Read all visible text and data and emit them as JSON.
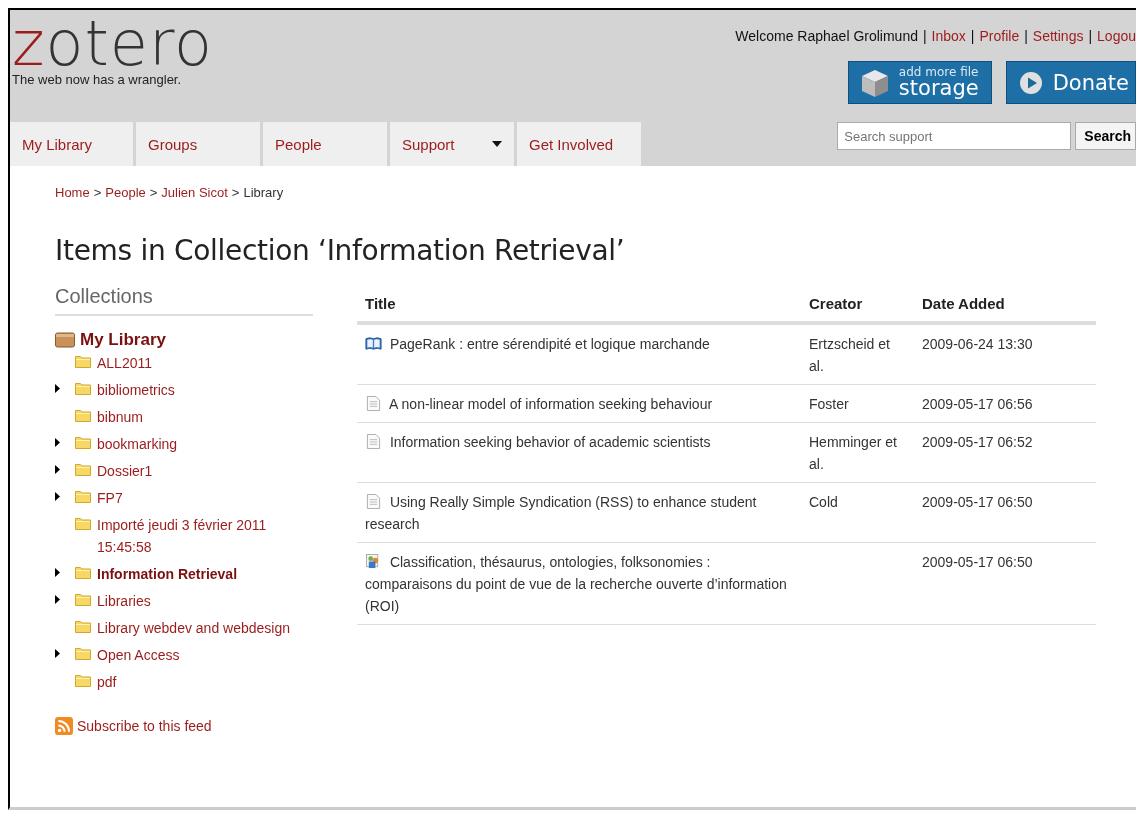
{
  "header": {
    "logo": [
      {
        "text": "z",
        "kind": "accent"
      },
      {
        "text": "otero",
        "kind": "plain"
      }
    ],
    "tagline": "The web now has a wrangler.",
    "user_links": [
      {
        "text": "Welcome Raphael Grolimund",
        "kind": "text"
      },
      {
        "text": "|",
        "kind": "separator"
      },
      {
        "text": "Inbox",
        "kind": "link"
      },
      {
        "text": "|",
        "kind": "separator"
      },
      {
        "text": "Profile",
        "kind": "link"
      },
      {
        "text": "|",
        "kind": "separator"
      },
      {
        "text": "Settings",
        "kind": "link"
      },
      {
        "text": "|",
        "kind": "separator"
      },
      {
        "text": "Logou",
        "kind": "link"
      }
    ],
    "storage_button": {
      "small": "add more file",
      "large": "storage"
    },
    "donate_button": "Donate",
    "nav": [
      {
        "label": "My Library",
        "dropdown": false
      },
      {
        "label": "Groups",
        "dropdown": false
      },
      {
        "label": "People",
        "dropdown": false
      },
      {
        "label": "Support",
        "dropdown": true
      },
      {
        "label": "Get Involved",
        "dropdown": false
      }
    ],
    "search": {
      "placeholder": "Search support",
      "button": "Search"
    }
  },
  "breadcrumb": [
    {
      "text": "Home",
      "kind": "link"
    },
    {
      "text": ">",
      "kind": "separator"
    },
    {
      "text": "People",
      "kind": "link"
    },
    {
      "text": ">",
      "kind": "separator"
    },
    {
      "text": "Julien Sicot",
      "kind": "link"
    },
    {
      "text": ">",
      "kind": "separator"
    },
    {
      "text": "Library",
      "kind": "current"
    }
  ],
  "page_title": "Items in Collection ‘Information Retrieval’",
  "collections": {
    "heading": "Collections",
    "root": {
      "label": "My Library",
      "children": [
        {
          "label": "ALL2011",
          "has_children": false,
          "selected": false
        },
        {
          "label": "bibliometrics",
          "has_children": true,
          "selected": false
        },
        {
          "label": "bibnum",
          "has_children": false,
          "selected": false
        },
        {
          "label": "bookmarking",
          "has_children": true,
          "selected": false
        },
        {
          "label": "Dossier1",
          "has_children": true,
          "selected": false
        },
        {
          "label": "FP7",
          "has_children": true,
          "selected": false
        },
        {
          "label": "Importé jeudi 3 février 2011 15:45:58",
          "has_children": false,
          "selected": false
        },
        {
          "label": "Information Retrieval",
          "has_children": true,
          "selected": true
        },
        {
          "label": "Libraries",
          "has_children": true,
          "selected": false
        },
        {
          "label": "Library webdev and webdesign",
          "has_children": false,
          "selected": false
        },
        {
          "label": "Open Access",
          "has_children": true,
          "selected": false
        },
        {
          "label": "pdf",
          "has_children": false,
          "selected": false
        }
      ]
    },
    "feed_link": "Subscribe to this feed"
  },
  "table": {
    "columns": [
      "Title",
      "Creator",
      "Date Added"
    ],
    "rows": [
      {
        "kind": "book",
        "title": "PageRank : entre sérendipité et logique marchande",
        "creator": "Ertzscheid et al.",
        "date": "2009-06-24 13:30"
      },
      {
        "kind": "document",
        "title": "A non-linear model of information seeking behaviour",
        "creator": "Foster",
        "date": "2009-05-17 06:56"
      },
      {
        "kind": "document",
        "title": "Information seeking behavior of academic scientists",
        "creator": "Hemminger et al.",
        "date": "2009-05-17 06:52"
      },
      {
        "kind": "document",
        "title": "Using Really Simple Syndication (RSS) to enhance student research",
        "creator": "Cold",
        "date": "2009-05-17 06:50"
      },
      {
        "kind": "presentation",
        "title": "Classification, thésaurus, ontologies, folksonomies : comparaisons du point de vue de la recherche ouverte d’information (ROI)",
        "creator": "",
        "date": "2009-05-17 06:50"
      }
    ]
  }
}
